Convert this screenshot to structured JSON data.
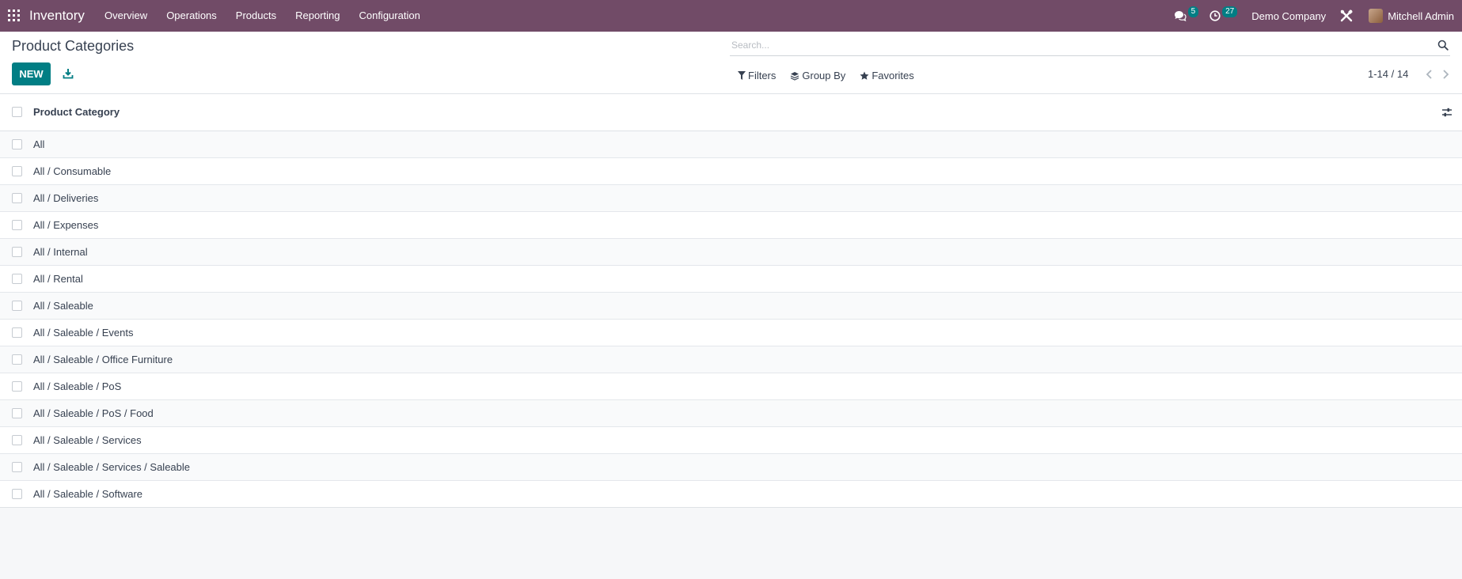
{
  "navbar": {
    "app_name": "Inventory",
    "menu": [
      "Overview",
      "Operations",
      "Products",
      "Reporting",
      "Configuration"
    ],
    "messages_count": "5",
    "activities_count": "27",
    "company": "Demo Company",
    "user": "Mitchell Admin",
    "icons": [
      "apps-grid-icon",
      "chat-icon",
      "clock-icon",
      "tools-icon"
    ]
  },
  "control_panel": {
    "title": "Product Categories",
    "new_label": "NEW",
    "search_placeholder": "Search...",
    "filters_label": "Filters",
    "group_by_label": "Group By",
    "favorites_label": "Favorites",
    "pager_value": "1-14 / 14"
  },
  "list": {
    "column_header": "Product Category",
    "rows": [
      "All",
      "All / Consumable",
      "All / Deliveries",
      "All / Expenses",
      "All / Internal",
      "All / Rental",
      "All / Saleable",
      "All / Saleable / Events",
      "All / Saleable / Office Furniture",
      "All / Saleable / PoS",
      "All / Saleable / PoS / Food",
      "All / Saleable / Services",
      "All / Saleable / Services / Saleable",
      "All / Saleable / Software"
    ]
  },
  "colors": {
    "navbar": "#714b67",
    "primary": "#017e84",
    "background": "#f6f7f9"
  }
}
